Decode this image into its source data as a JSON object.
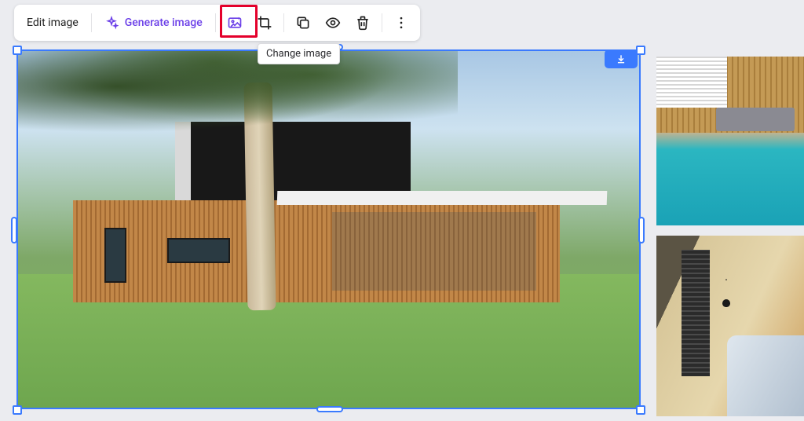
{
  "toolbar": {
    "edit_label": "Edit image",
    "generate_label": "Generate image",
    "tooltip_change": "Change image",
    "icons": {
      "sparkle": "sparkle-icon",
      "change_image": "image-icon",
      "crop": "crop-icon",
      "copy": "copy-icon",
      "visibility": "eye-icon",
      "delete": "trash-icon",
      "more": "more-vertical-icon"
    }
  },
  "selection": {
    "download_icon": "download-icon"
  }
}
